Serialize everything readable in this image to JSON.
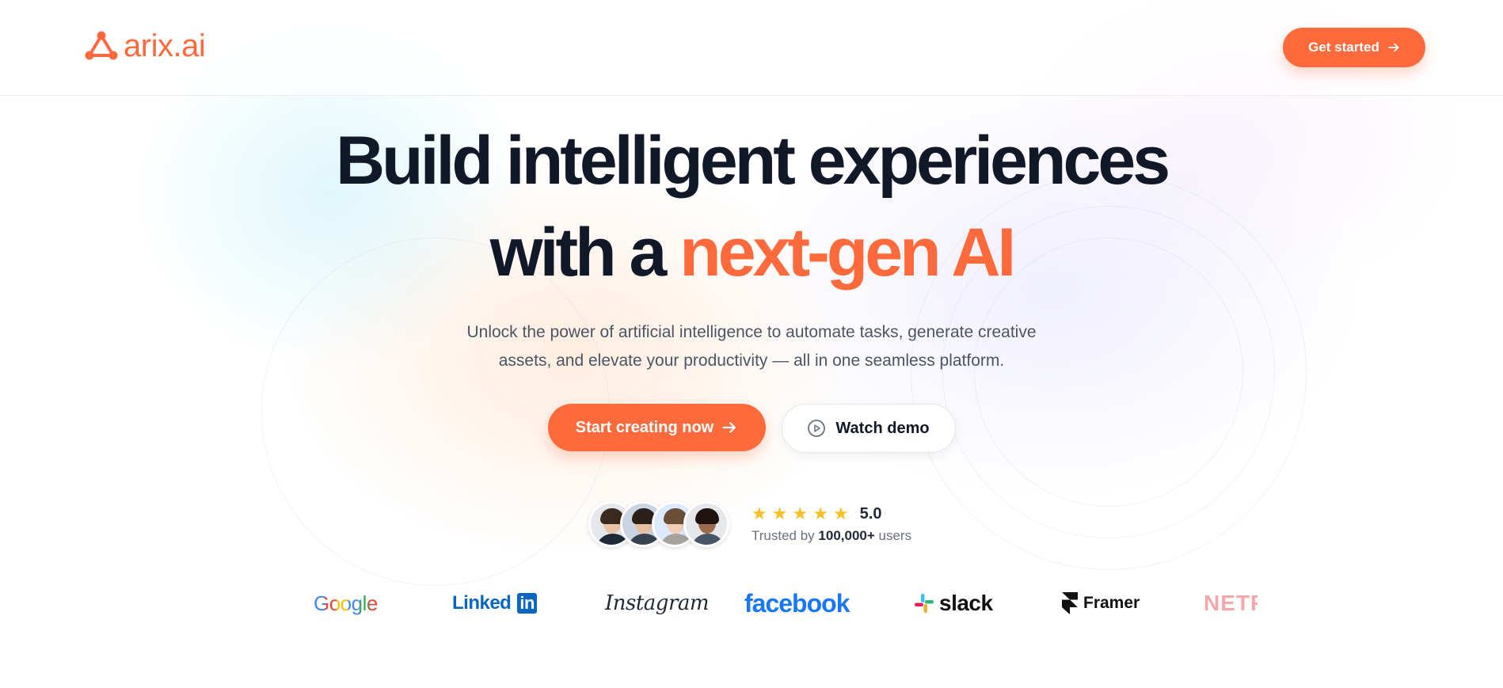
{
  "brand": {
    "name": "arix.ai",
    "logo_icon": "triangle-nodes-icon",
    "accent_color": "#ff6a3d"
  },
  "header": {
    "cta_label": "Get started",
    "cta_icon": "arrow-right-icon"
  },
  "hero": {
    "title_line1": "Build intelligent experiences",
    "title_line2_prefix": "with a ",
    "title_line2_accent": "next-gen AI",
    "subtitle_line1": "Unlock the power of artificial intelligence to automate tasks, generate creative",
    "subtitle_line2": "assets, and elevate your productivity — all in one seamless platform."
  },
  "cta": {
    "primary_label": "Start creating now",
    "primary_icon": "arrow-right-icon",
    "secondary_label": "Watch demo",
    "secondary_icon": "play-circle-icon"
  },
  "social_proof": {
    "avatar_count": 4,
    "stars": 5,
    "score": "5.0",
    "trusted_prefix": "Trusted by ",
    "trusted_count": "100,000+",
    "trusted_suffix": " users"
  },
  "logos": [
    {
      "name": "Google",
      "icon": "google-logo"
    },
    {
      "name": "Linked",
      "badge": "in",
      "icon": "linkedin-logo"
    },
    {
      "name": "Instagram",
      "icon": "instagram-logo"
    },
    {
      "name": "facebook",
      "icon": "facebook-logo"
    },
    {
      "name": "slack",
      "icon": "slack-logo"
    },
    {
      "name": "Framer",
      "icon": "framer-logo"
    },
    {
      "name": "NETFLIX",
      "icon": "netflix-logo"
    }
  ]
}
